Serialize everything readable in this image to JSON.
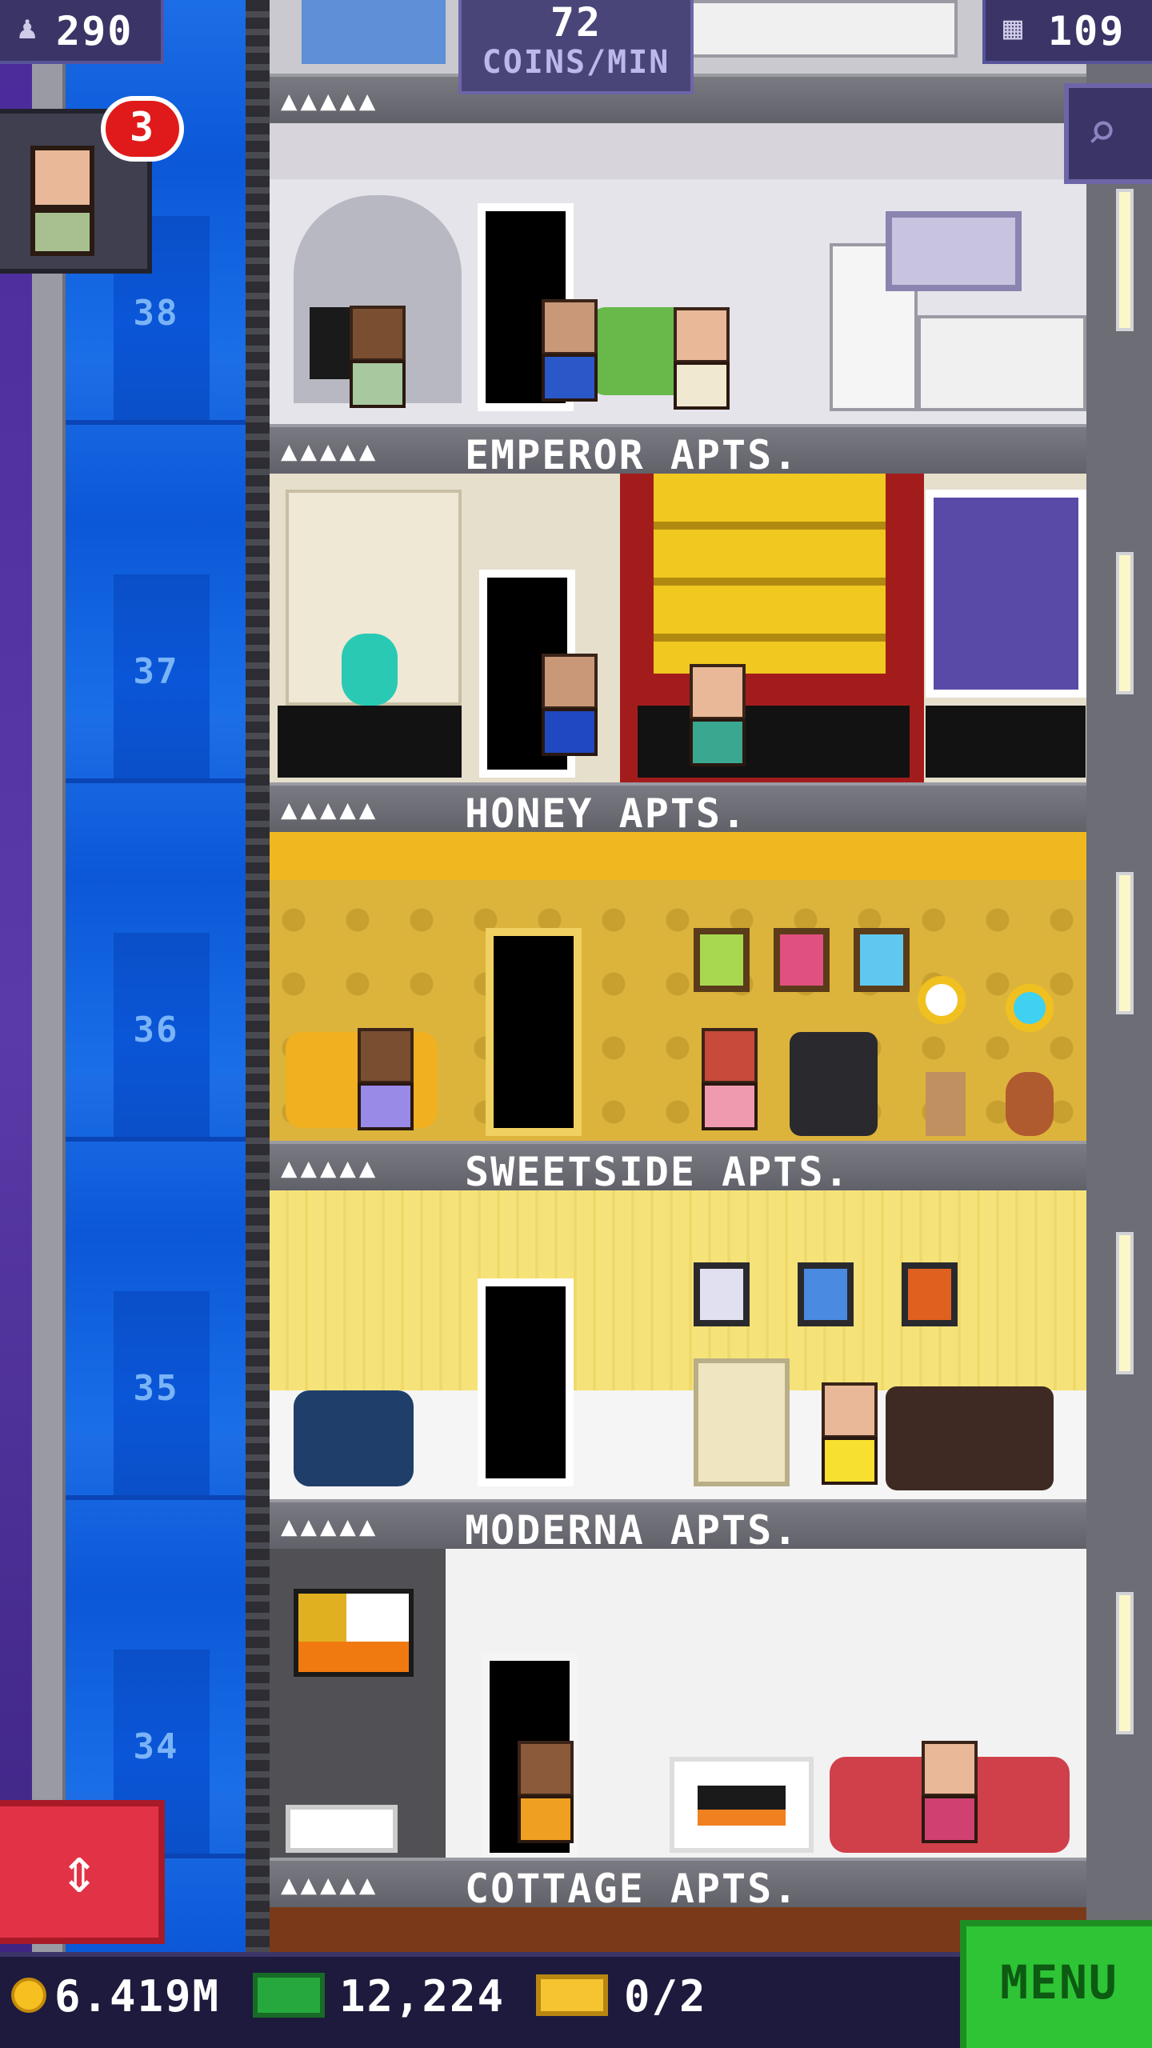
{
  "hud": {
    "population": "290",
    "coins_rate_value": "72",
    "coins_rate_unit": "COINS/MIN",
    "floor_count": "109"
  },
  "visitor": {
    "badge_count": "3"
  },
  "floors": [
    {
      "number": "38",
      "name": "EMPEROR APTS.",
      "people": "▲▲▲▲▲"
    },
    {
      "number": "37",
      "name": "HONEY APTS.",
      "people": "▲▲▲▲▲"
    },
    {
      "number": "36",
      "name": "SWEETSIDE APTS.",
      "people": "▲▲▲▲▲"
    },
    {
      "number": "35",
      "name": "MODERNA APTS.",
      "people": "▲▲▲▲▲"
    },
    {
      "number": "34",
      "name": "COTTAGE APTS.",
      "people": "▲▲▲▲▲"
    }
  ],
  "bottom": {
    "coins": "6.419M",
    "bux": "12,224",
    "tickets": "0/2",
    "menu_label": "MENU"
  },
  "colors": {
    "elevator_blue": "#0b58d8",
    "menu_green": "#2ec436",
    "elevator_button_red": "#e23346",
    "badge_red": "#e01a1a"
  }
}
